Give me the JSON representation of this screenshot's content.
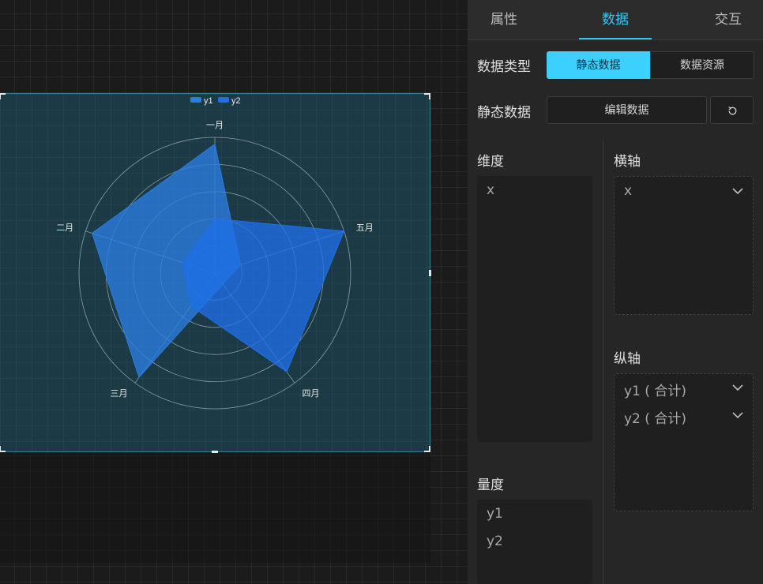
{
  "tabs": [
    {
      "label": "属性",
      "active": false
    },
    {
      "label": "数据",
      "active": true
    },
    {
      "label": "交互",
      "active": false
    }
  ],
  "data_type": {
    "label": "数据类型",
    "options": [
      "静态数据",
      "数据资源"
    ],
    "selected": "静态数据"
  },
  "static_data": {
    "label": "静态数据",
    "edit_button": "编辑数据",
    "reset_icon": "refresh-icon"
  },
  "dimension": {
    "label": "维度",
    "items": [
      "x"
    ]
  },
  "measure": {
    "label": "量度",
    "items": [
      "y1",
      "y2"
    ]
  },
  "x_axis": {
    "label": "横轴",
    "items": [
      "x"
    ]
  },
  "y_axis": {
    "label": "纵轴",
    "items": [
      "y1 ( 合计)",
      "y2 ( 合计)"
    ]
  },
  "colors": {
    "accent": "#38c5f5",
    "y1": "#2a7de1",
    "y2": "#1f6fe8"
  },
  "chart_data": {
    "type": "radar",
    "indicators": [
      "一月",
      "五月",
      "四月",
      "三月",
      "二月"
    ],
    "max": 100,
    "series": [
      {
        "name": "y1",
        "values": [
          95,
          20,
          10,
          95,
          95
        ]
      },
      {
        "name": "y2",
        "values": [
          40,
          100,
          90,
          30,
          25
        ]
      }
    ],
    "legend": "top-center",
    "rings": 5
  }
}
